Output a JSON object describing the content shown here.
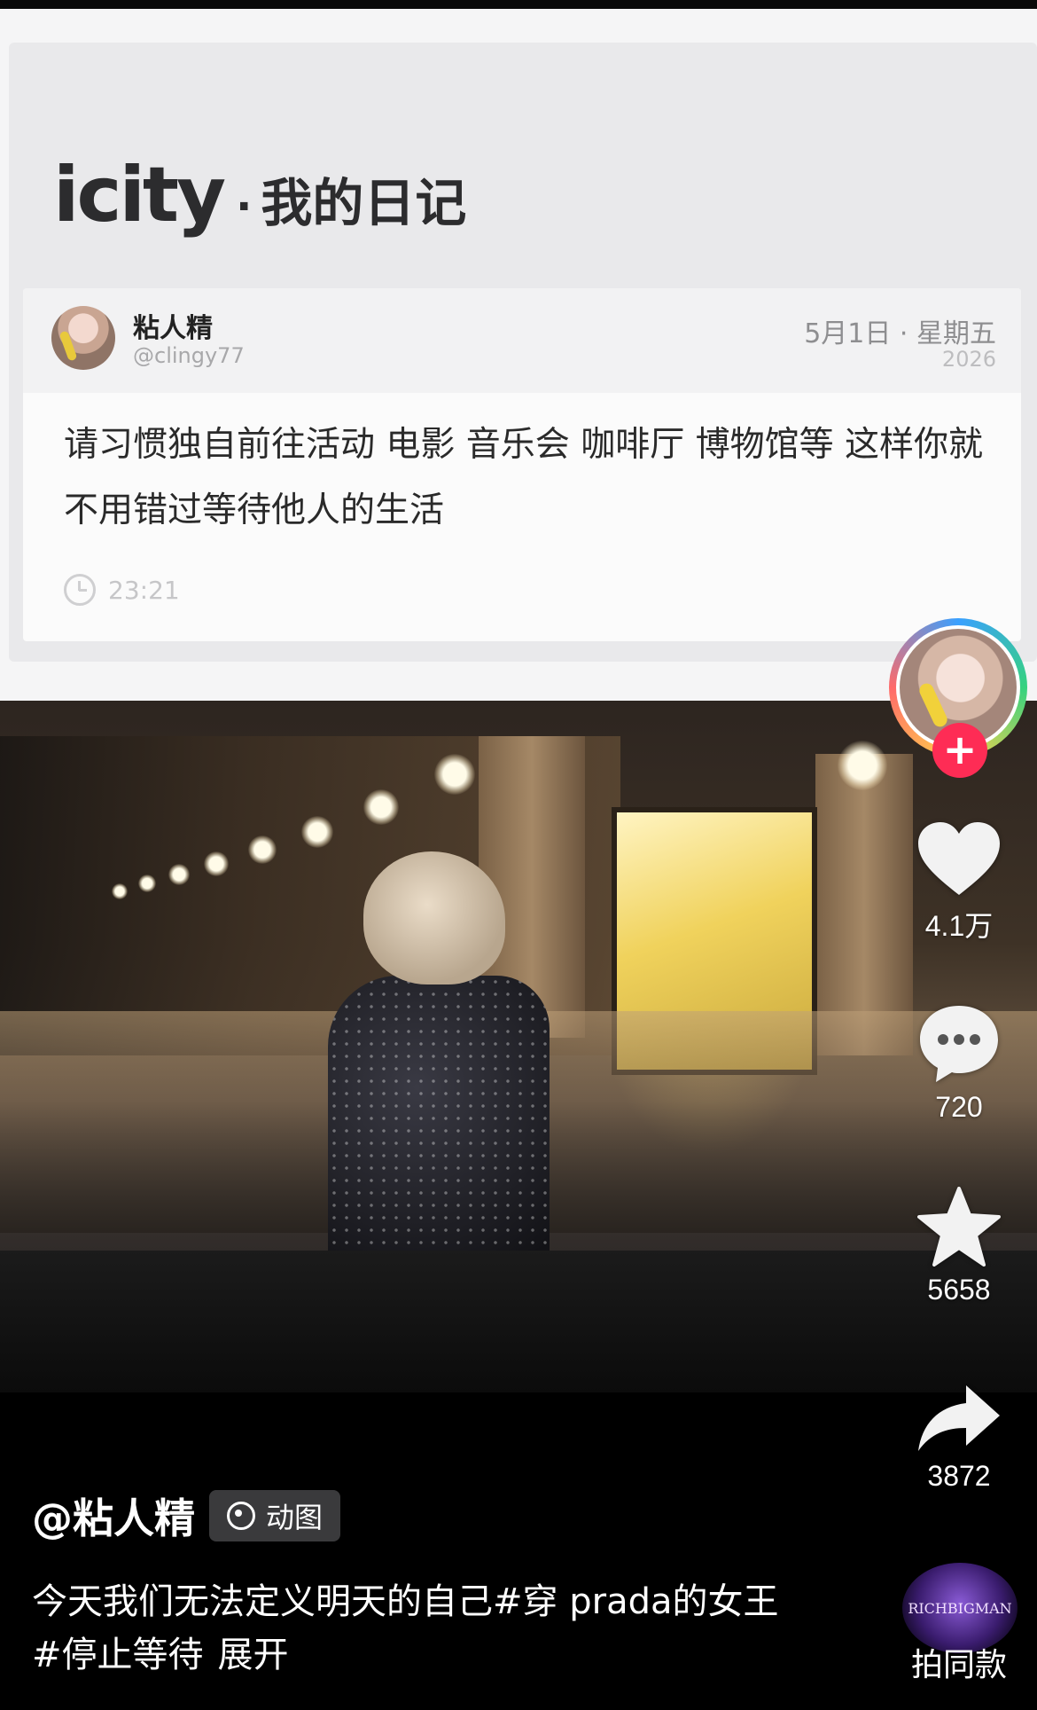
{
  "diary_card": {
    "brand_logo": "icity",
    "brand_separator": "·",
    "brand_subtitle": "我的日记",
    "author_name": "粘人精",
    "author_handle": "@clingy77",
    "date": "5月1日 · 星期五",
    "year": "2026",
    "body": "请习惯独自前往活动 电影 音乐会 咖啡厅 博物馆等 这样你就不用错过等待他人的生活",
    "time": "23:21"
  },
  "actions": {
    "likes": "4.1万",
    "comments": "720",
    "favorites": "5658",
    "shares": "3872",
    "follow_symbol": "+"
  },
  "post": {
    "author": "@粘人精",
    "tag": "动图",
    "caption": "今天我们无法定义明天的自己#穿 prada的女王 #停止等待",
    "expand": "展开"
  },
  "music": {
    "disc_label": "RICHBIGMAN",
    "same_style": "拍同款"
  },
  "colors": {
    "follow": "#fe2c55",
    "background": "#000000"
  },
  "icons": [
    "heart-icon",
    "comment-icon",
    "star-icon",
    "share-icon",
    "clock-icon",
    "live-photo-icon"
  ]
}
